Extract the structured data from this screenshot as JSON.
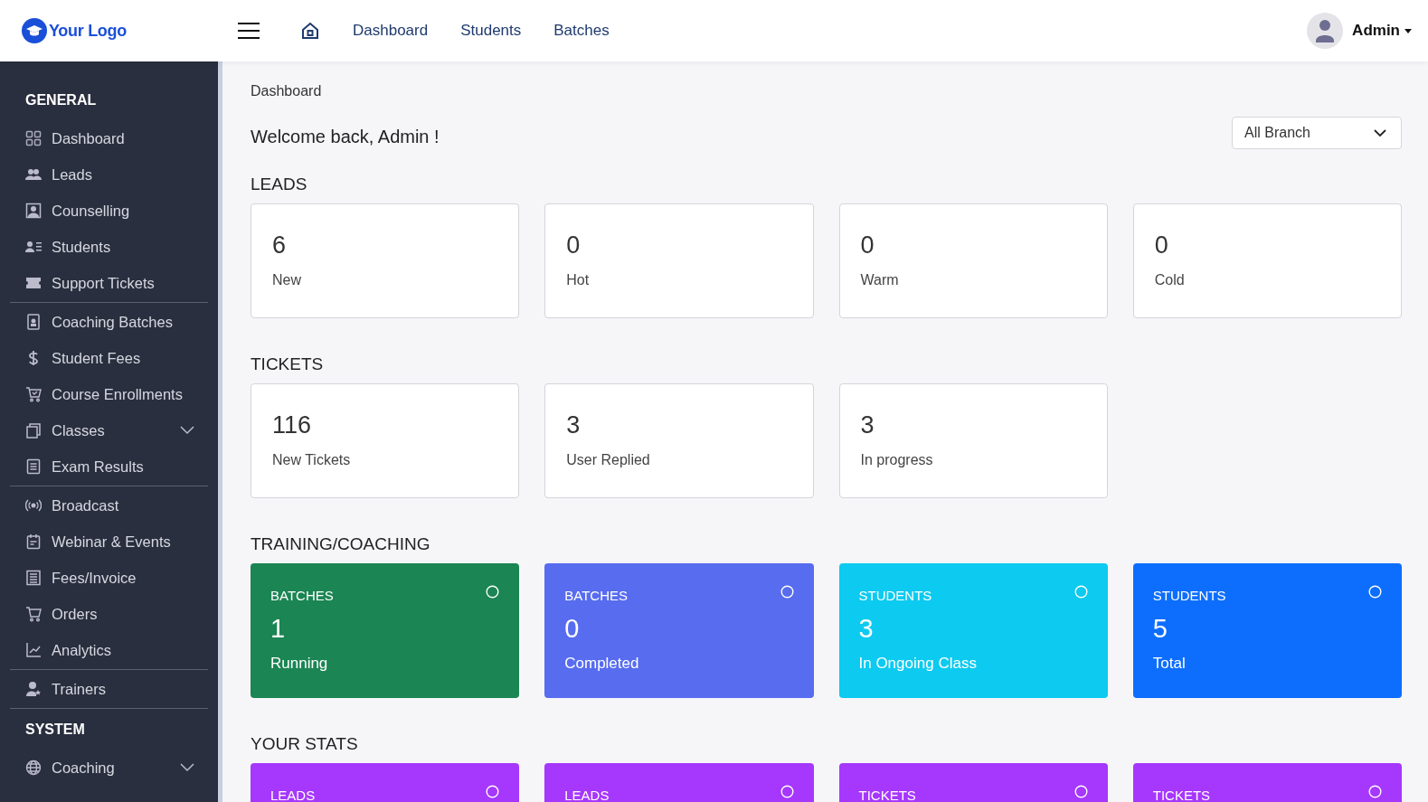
{
  "header": {
    "logo": "Your Logo",
    "nav": [
      {
        "label": "Dashboard"
      },
      {
        "label": "Students"
      },
      {
        "label": "Batches"
      }
    ],
    "user": "Admin"
  },
  "sidebar": {
    "sections": [
      {
        "title": "GENERAL",
        "groups": [
          [
            {
              "label": "Dashboard"
            },
            {
              "label": "Leads"
            },
            {
              "label": "Counselling"
            },
            {
              "label": "Students"
            },
            {
              "label": "Support Tickets"
            }
          ],
          [
            {
              "label": "Coaching Batches"
            },
            {
              "label": "Student Fees"
            },
            {
              "label": "Course Enrollments"
            },
            {
              "label": "Classes",
              "expanded": false
            },
            {
              "label": "Exam Results"
            }
          ],
          [
            {
              "label": "Broadcast"
            },
            {
              "label": "Webinar & Events"
            },
            {
              "label": "Fees/Invoice"
            },
            {
              "label": "Orders"
            },
            {
              "label": "Analytics"
            }
          ],
          [
            {
              "label": "Trainers"
            }
          ]
        ]
      },
      {
        "title": "SYSTEM",
        "groups": [
          [
            {
              "label": "Coaching",
              "expanded": false
            }
          ]
        ]
      }
    ]
  },
  "breadcrumb": "Dashboard",
  "welcome": "Welcome back, Admin !",
  "branch_select": {
    "value": "All Branch"
  },
  "sections": [
    {
      "title": "LEADS",
      "kind": "plain",
      "cards": [
        {
          "value": "6",
          "label": "New"
        },
        {
          "value": "0",
          "label": "Hot"
        },
        {
          "value": "0",
          "label": "Warm"
        },
        {
          "value": "0",
          "label": "Cold"
        }
      ]
    },
    {
      "title": "TICKETS",
      "kind": "plain",
      "cards": [
        {
          "value": "116",
          "label": "New Tickets"
        },
        {
          "value": "3",
          "label": "User Replied"
        },
        {
          "value": "3",
          "label": "In progress"
        }
      ]
    },
    {
      "title": "TRAINING/COACHING",
      "kind": "colored",
      "cards": [
        {
          "heading": "BATCHES",
          "value": "1",
          "label": "Running",
          "color": "#1b8553"
        },
        {
          "heading": "BATCHES",
          "value": "0",
          "label": "Completed",
          "color": "#576cef"
        },
        {
          "heading": "STUDENTS",
          "value": "3",
          "label": "In Ongoing Class",
          "color": "#0dcaf0"
        },
        {
          "heading": "STUDENTS",
          "value": "5",
          "label": "Total",
          "color": "#0d6efd"
        }
      ]
    },
    {
      "title": "YOUR STATS",
      "kind": "colored",
      "cards": [
        {
          "heading": "LEADS",
          "color": "#a637fd"
        },
        {
          "heading": "LEADS",
          "color": "#a637fd"
        },
        {
          "heading": "TICKETS",
          "color": "#a637fd"
        },
        {
          "heading": "TICKETS",
          "color": "#a637fd"
        }
      ]
    }
  ]
}
